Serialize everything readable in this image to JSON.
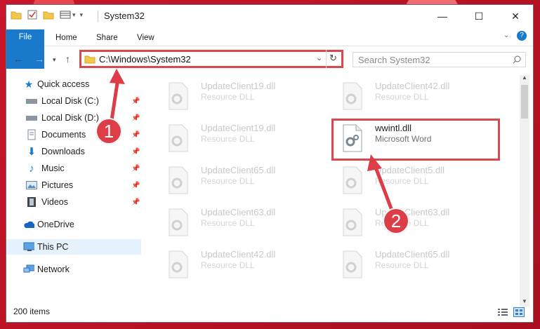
{
  "window": {
    "title": "System32"
  },
  "ribbon": {
    "tabs": [
      "File",
      "Home",
      "Share",
      "View"
    ]
  },
  "address": {
    "path": "C:\\Windows\\System32"
  },
  "search": {
    "placeholder": "Search System32"
  },
  "sidebar": {
    "items": [
      {
        "label": "Quick access",
        "icon": "star-icon",
        "pinned": false
      },
      {
        "label": "Local Disk (C:)",
        "icon": "drive-icon",
        "pinned": true
      },
      {
        "label": "Local Disk (D:)",
        "icon": "drive-icon",
        "pinned": true
      },
      {
        "label": "Documents",
        "icon": "documents-icon",
        "pinned": true
      },
      {
        "label": "Downloads",
        "icon": "download-icon",
        "pinned": true
      },
      {
        "label": "Music",
        "icon": "music-icon",
        "pinned": true
      },
      {
        "label": "Pictures",
        "icon": "pictures-icon",
        "pinned": true
      },
      {
        "label": "Videos",
        "icon": "videos-icon",
        "pinned": true
      },
      {
        "label": "OneDrive",
        "icon": "cloud-icon",
        "pinned": false
      },
      {
        "label": "This PC",
        "icon": "computer-icon",
        "pinned": false,
        "selected": true
      },
      {
        "label": "Network",
        "icon": "network-icon",
        "pinned": false
      }
    ]
  },
  "files": [
    {
      "name": "UpdateClient19.dll",
      "type": "Resource DLL"
    },
    {
      "name": "UpdateClient42.dll",
      "type": "Resource DLL"
    },
    {
      "name": "UpdateClient19.dll",
      "type": "Resource DLL"
    },
    {
      "name": "wwintl.dll",
      "type": "Microsoft Word",
      "highlighted": true
    },
    {
      "name": "UpdateClient65.dll",
      "type": "Resource DLL"
    },
    {
      "name": "UpdateClient5.dll",
      "type": "Resource DLL"
    },
    {
      "name": "UpdateClient63.dll",
      "type": "Resource DLL"
    },
    {
      "name": "UpdateClient63.dll",
      "type": "Resource DLL"
    },
    {
      "name": "UpdateClient42.dll",
      "type": "Resource DLL"
    },
    {
      "name": "UpdateClient65.dll",
      "type": "Resource DLL"
    }
  ],
  "status": {
    "item_count": "200 items"
  },
  "annotations": {
    "step1": "1",
    "step2": "2"
  },
  "colors": {
    "accent": "#1979ca",
    "highlight": "#d9484e",
    "background": "#c6182a"
  }
}
